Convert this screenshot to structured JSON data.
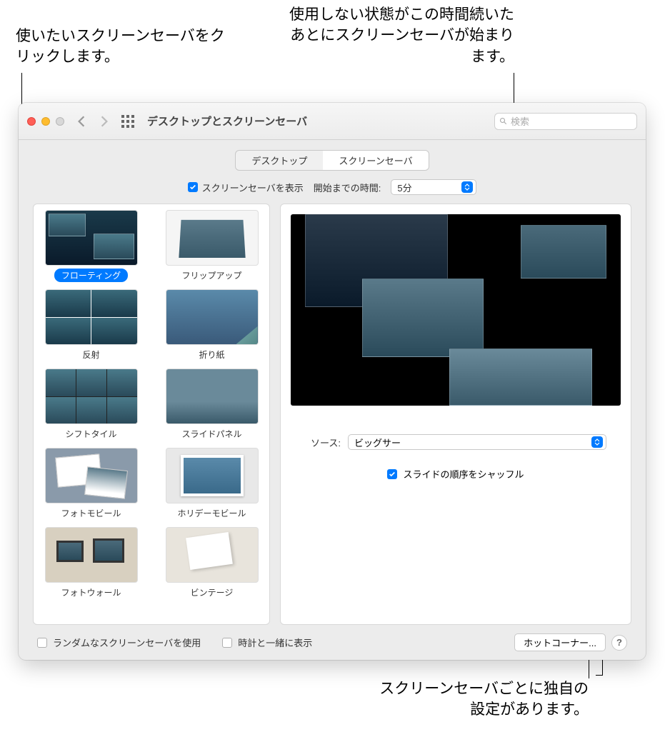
{
  "callouts": {
    "c1": "使いたいスクリーンセーバをクリックします。",
    "c2": "使用しない状態がこの時間続いたあとにスクリーンセーバが始まります。",
    "c3": "スクリーンセーバごとに独自の設定があります。"
  },
  "window": {
    "title": "デスクトップとスクリーンセーバ",
    "search_placeholder": "検索"
  },
  "tabs": {
    "desktop": "デスクトップ",
    "screensaver": "スクリーンセーバ"
  },
  "toprow": {
    "show_label": "スクリーンセーバを表示",
    "start_label": "開始までの時間:",
    "start_value": "5分"
  },
  "screensavers": [
    {
      "label": "フローティング",
      "cls": "t-float",
      "selected": true
    },
    {
      "label": "フリップアップ",
      "cls": "t-flip"
    },
    {
      "label": "反射",
      "cls": "t-reflect"
    },
    {
      "label": "折り紙",
      "cls": "t-origami"
    },
    {
      "label": "シフトタイル",
      "cls": "t-shift"
    },
    {
      "label": "スライドパネル",
      "cls": "t-slide"
    },
    {
      "label": "フォトモビール",
      "cls": "t-photo"
    },
    {
      "label": "ホリデーモビール",
      "cls": "t-holiday"
    },
    {
      "label": "フォトウォール",
      "cls": "t-wall"
    },
    {
      "label": "ビンテージ",
      "cls": "t-vintage"
    }
  ],
  "options": {
    "source_label": "ソース:",
    "source_value": "ビッグサー",
    "shuffle_label": "スライドの順序をシャッフル"
  },
  "bottom": {
    "random": "ランダムなスクリーンセーバを使用",
    "clock": "時計と一緒に表示",
    "hotcorners": "ホットコーナー...",
    "help": "?"
  }
}
